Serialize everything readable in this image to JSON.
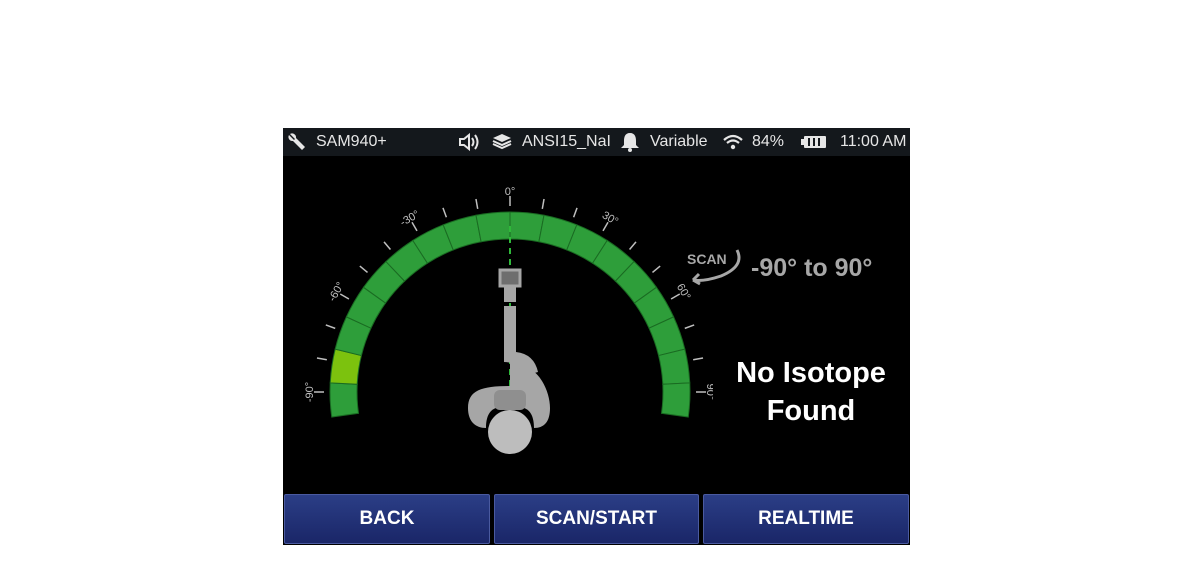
{
  "status_bar": {
    "device_name": "SAM940+",
    "library": "ANSI15_NaI",
    "alarm_mode": "Variable",
    "battery_percent": "84%",
    "time": "11:00 AM",
    "icons": [
      "wrench-icon",
      "speaker-icon",
      "library-icon",
      "bell-icon",
      "wifi-icon",
      "battery-icon"
    ]
  },
  "gauge": {
    "tick_labels": [
      "-90°",
      "-60°",
      "-30°",
      "0°",
      "30°",
      "60°",
      "90°"
    ],
    "segment_count": 18,
    "active_segment_index": 1,
    "colors": {
      "segment": "#2e9e3a",
      "active_segment": "#7cc20e",
      "divider": "#1a6b22",
      "center_line": "#2fb83a",
      "ticks": "#bfbfbf"
    }
  },
  "scan": {
    "logo_text": "SCAN",
    "range_text": "-90° to 90°"
  },
  "result": {
    "line1": "No Isotope",
    "line2": "Found"
  },
  "buttons": {
    "back": "BACK",
    "scan_start": "SCAN/START",
    "realtime": "REALTIME"
  },
  "colors": {
    "button_bg": "#22317a",
    "status_bg": "#14181c",
    "screen_bg": "#000000"
  }
}
